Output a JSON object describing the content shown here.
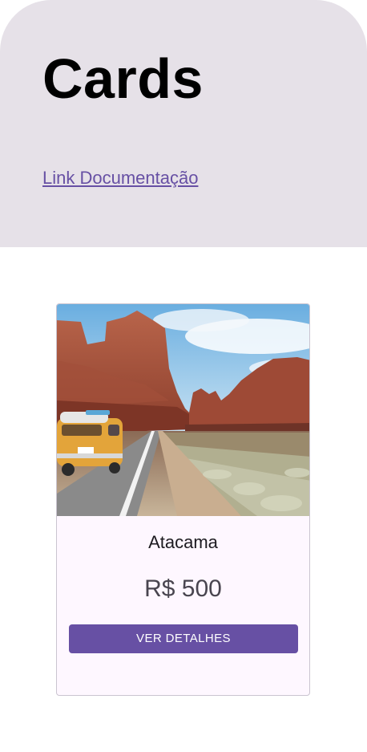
{
  "header": {
    "title": "Cards",
    "doc_link": "Link Documentação"
  },
  "card": {
    "image_alt": "road-trip-van-desert-photo",
    "title": "Atacama",
    "price": "R$ 500",
    "button_label": "VER DETALHES"
  },
  "colors": {
    "header_bg": "#e6e1e8",
    "accent": "#6750a4",
    "card_bg": "#fef7ff"
  }
}
